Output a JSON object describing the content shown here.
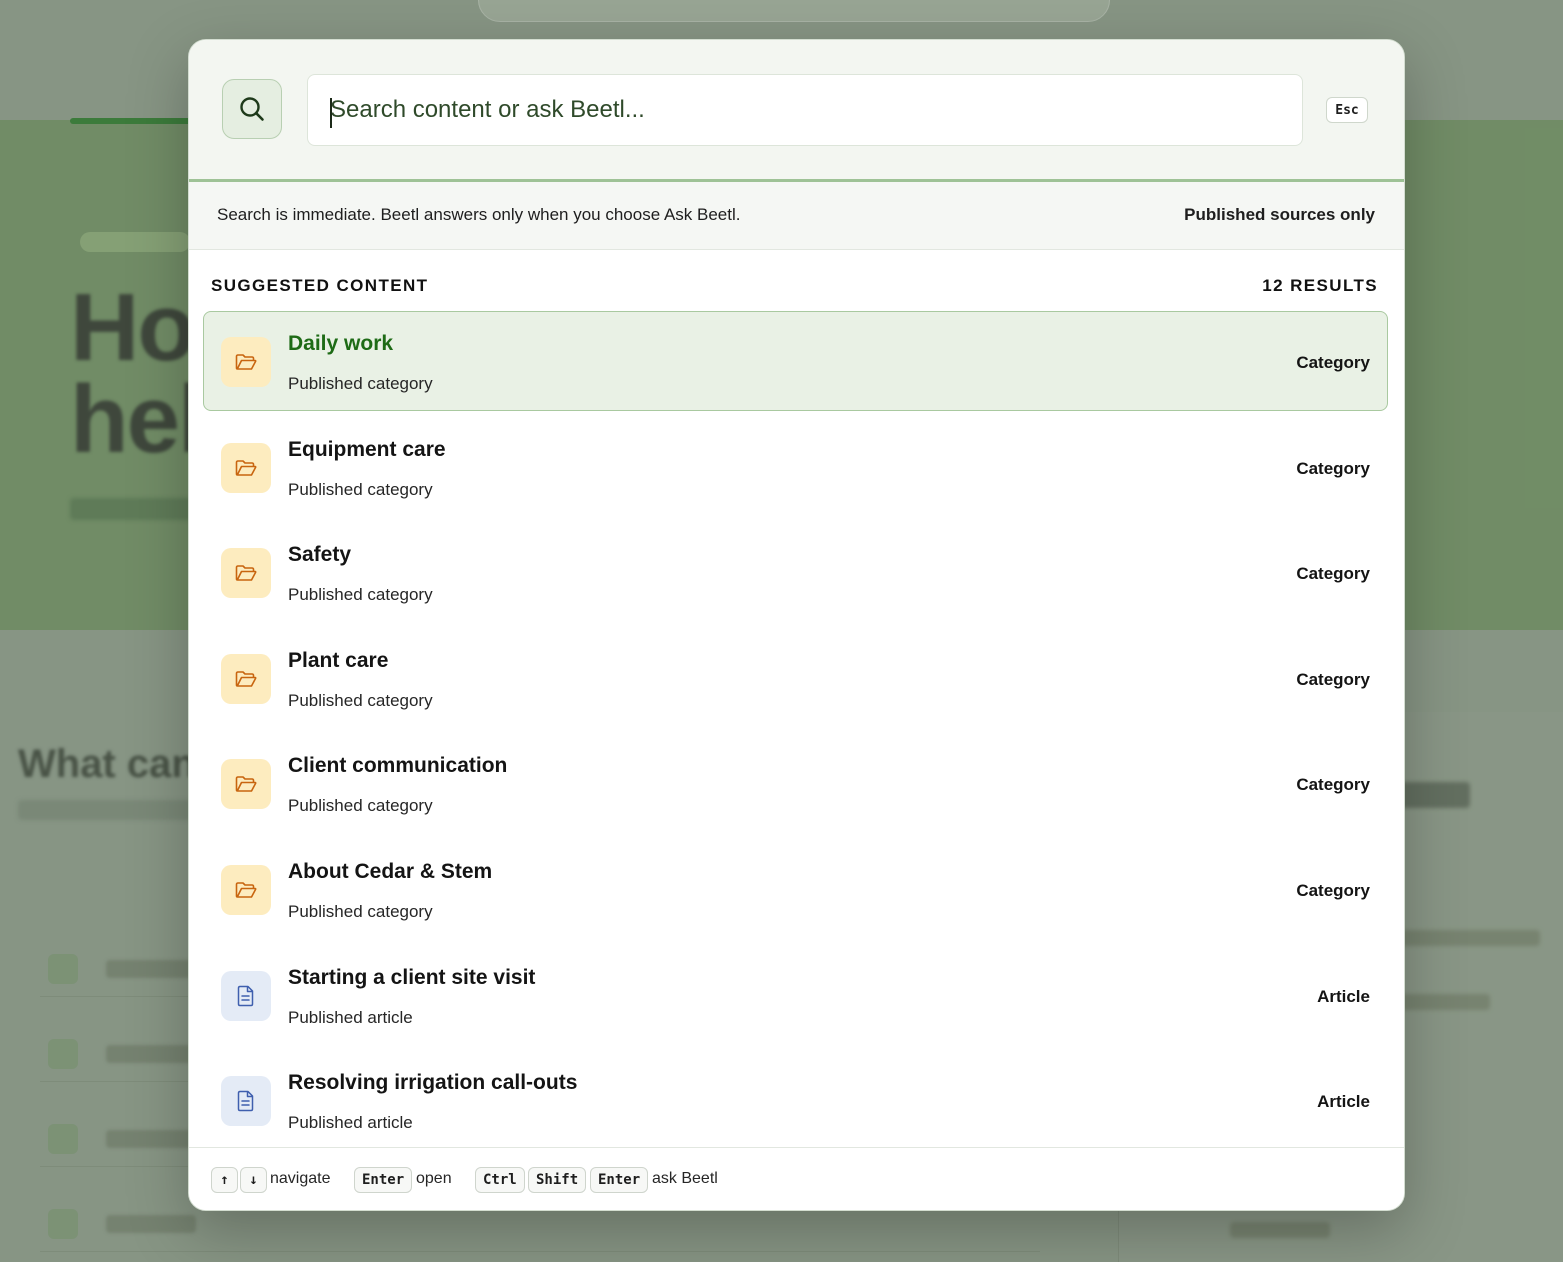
{
  "background": {
    "hero_title_line1": "Ho",
    "hero_title_line2": "hel",
    "section_title": "What can"
  },
  "search": {
    "placeholder": "Search content or ask Beetl...",
    "value": "",
    "esc_label": "Esc"
  },
  "info": {
    "text": "Search is immediate. Beetl answers only when you choose Ask Beetl.",
    "scope": "Published sources only"
  },
  "results": {
    "heading": "SUGGESTED CONTENT",
    "count": "12 RESULTS",
    "items": [
      {
        "title": "Daily work",
        "subtitle": "Published category",
        "type": "Category",
        "icon": "folder-icon",
        "active": true
      },
      {
        "title": "Equipment care",
        "subtitle": "Published category",
        "type": "Category",
        "icon": "folder-icon"
      },
      {
        "title": "Safety",
        "subtitle": "Published category",
        "type": "Category",
        "icon": "folder-icon"
      },
      {
        "title": "Plant care",
        "subtitle": "Published category",
        "type": "Category",
        "icon": "folder-icon"
      },
      {
        "title": "Client communication",
        "subtitle": "Published category",
        "type": "Category",
        "icon": "folder-icon"
      },
      {
        "title": "About Cedar & Stem",
        "subtitle": "Published category",
        "type": "Category",
        "icon": "folder-icon"
      },
      {
        "title": "Starting a client site visit",
        "subtitle": "Published article",
        "type": "Article",
        "icon": "document-icon"
      },
      {
        "title": "Resolving irrigation call-outs",
        "subtitle": "Published article",
        "type": "Article",
        "icon": "document-icon"
      }
    ]
  },
  "footer": {
    "up_key": "↑",
    "down_key": "↓",
    "navigate_label": "navigate",
    "enter_key": "Enter",
    "open_label": "open",
    "ctrl_key": "Ctrl",
    "shift_key": "Shift",
    "enter_key2": "Enter",
    "ask_label": "ask Beetl"
  },
  "colors": {
    "accent_green": "#1e6b16",
    "active_row_bg": "#e9f1e5",
    "folder_icon_bg": "#fdecbf",
    "folder_icon": "#c8650f",
    "document_icon_bg": "#e4ebf6",
    "document_icon": "#3f5fae"
  }
}
